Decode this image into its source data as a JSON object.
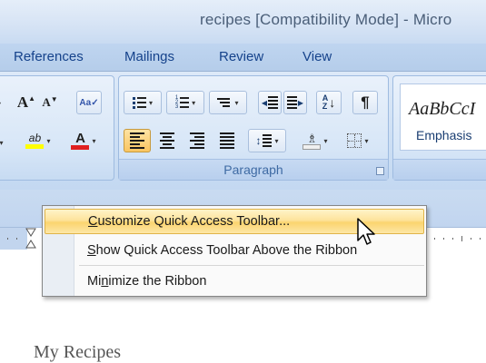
{
  "window": {
    "title": "recipes [Compatibility Mode] - Micro"
  },
  "tabs": [
    {
      "label": "References"
    },
    {
      "label": "Mailings"
    },
    {
      "label": "Review"
    },
    {
      "label": "View"
    }
  ],
  "ribbon": {
    "font_group": {
      "grow_font": "A",
      "shrink_font": "A",
      "highlight_letters": "ab",
      "font_color_letter": "A"
    },
    "paragraph_group": {
      "label": "Paragraph"
    },
    "styles_group": {
      "sample_text": "AaBbCcI",
      "style_name": "Emphasis"
    }
  },
  "context_menu": {
    "items": [
      {
        "label": "Customize Quick Access Toolbar...",
        "accelerator": "C"
      },
      {
        "label": "Show Quick Access Toolbar Above the Ribbon",
        "accelerator": "S"
      },
      {
        "label": "Minimize the Ribbon",
        "accelerator": "n"
      }
    ]
  },
  "document": {
    "text": "My Recipes"
  },
  "colors": {
    "accent": "#15428b",
    "highlight_yellow": "#ffff00",
    "font_color_red": "#e02020",
    "menu_hover": "#fde39b"
  }
}
